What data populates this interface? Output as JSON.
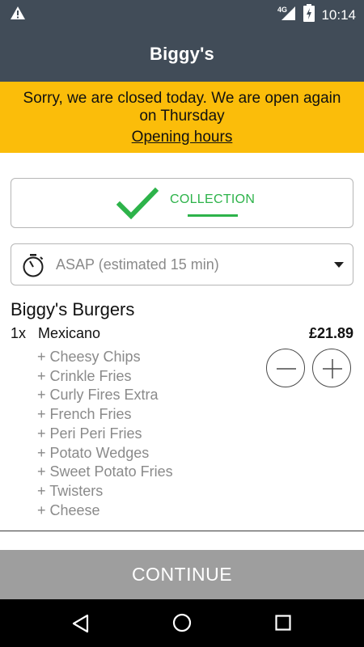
{
  "status_bar": {
    "time": "10:14",
    "network": "4G",
    "icons": [
      "warning-icon",
      "signal-icon",
      "battery-icon"
    ]
  },
  "app_bar": {
    "title": "Biggy's"
  },
  "banner": {
    "message": "Sorry, we are closed today. We are open again on Thursday",
    "link": "Opening hours",
    "color": "#fbbd0a"
  },
  "collection": {
    "label": "COLLECTION",
    "selected": true,
    "color": "#2db34a"
  },
  "time_select": {
    "value": "ASAP (estimated 15 min)"
  },
  "order": {
    "restaurant": "Biggy's Burgers",
    "item": {
      "qty": "1x",
      "name": "Mexicano",
      "price": "£21.89",
      "modifiers": [
        "+ Cheesy Chips",
        "+ Crinkle Fries",
        "+ Curly Fires Extra",
        "+ French Fries",
        "+ Peri Peri Fries",
        "+ Potato Wedges",
        "+ Sweet Potato Fries",
        "+ Twisters",
        "+ Cheese"
      ]
    }
  },
  "continue_label": "CONTINUE",
  "colors": {
    "header": "#414c58",
    "continue_disabled": "#9e9e9e"
  }
}
